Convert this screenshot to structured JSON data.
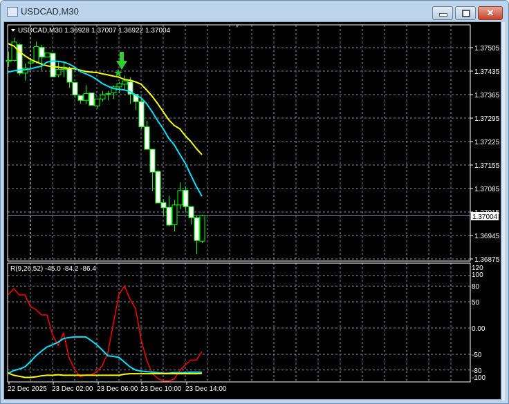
{
  "window": {
    "title": "USDCAD,M30",
    "minimize_icon": "minimize-icon",
    "maximize_icon": "maximize-icon",
    "close_icon": "close-icon"
  },
  "chart": {
    "header": "USDCAD,M30  1.36928 1.37007 1.36922 1.37004",
    "current_price": "1.37004",
    "price_ticks": [
      "1.37505",
      "1.37435",
      "1.37365",
      "1.37295",
      "1.37225",
      "1.37155",
      "1.37085",
      "1.37015",
      "1.36945",
      "1.36875"
    ],
    "time_ticks": [
      "22 Dec 2025",
      "23 Dec 02:00",
      "23 Dec 06:00",
      "23 Dec 10:00",
      "23 Dec 14:00"
    ],
    "colors": {
      "bull_outline": "#00ff00",
      "bear_body": "#ffffff",
      "ma_fast": "#00e5ff",
      "ma_slow": "#ffff00",
      "signal_arrow": "#32cd32",
      "indicator_red": "#ff0000"
    },
    "markers": {
      "sell_arrow": "arrow-down-icon",
      "signal_star": "star-icon"
    }
  },
  "indicator": {
    "header": "R(9,26,52) -45.0 -84.2 -86.4",
    "ticks": [
      "120",
      "100",
      "80",
      "50",
      "0.00",
      "-50",
      "-80",
      "-100"
    ]
  },
  "chart_data": [
    {
      "type": "candlestick",
      "symbol": "USDCAD",
      "timeframe": "M30",
      "ylim": [
        1.36875,
        1.37505
      ],
      "grid": true,
      "ohlc": [
        [
          1.37464,
          1.37493,
          1.37448,
          1.37467
        ],
        [
          1.37467,
          1.37534,
          1.37463,
          1.37522
        ],
        [
          1.37514,
          1.37517,
          1.37422,
          1.37429
        ],
        [
          1.37429,
          1.37458,
          1.37407,
          1.37444
        ],
        [
          1.37459,
          1.37475,
          1.37451,
          1.37462
        ],
        [
          1.37462,
          1.37523,
          1.37458,
          1.37508
        ],
        [
          1.37506,
          1.37513,
          1.37438,
          1.37477
        ],
        [
          1.37477,
          1.37489,
          1.37477,
          1.37489
        ],
        [
          1.37488,
          1.37489,
          1.37417,
          1.37418
        ],
        [
          1.37424,
          1.37462,
          1.37417,
          1.3744
        ],
        [
          1.3744,
          1.37462,
          1.37417,
          1.37447
        ],
        [
          1.37442,
          1.37448,
          1.37385,
          1.37402
        ],
        [
          1.37401,
          1.37401,
          1.37355,
          1.37364
        ],
        [
          1.37362,
          1.37362,
          1.37338,
          1.37348
        ],
        [
          1.37348,
          1.37393,
          1.37337,
          1.37368
        ],
        [
          1.3737,
          1.3737,
          1.37333,
          1.37333
        ],
        [
          1.37331,
          1.37352,
          1.37323,
          1.37352
        ],
        [
          1.37352,
          1.37376,
          1.37344,
          1.37364
        ],
        [
          1.37366,
          1.37376,
          1.37348,
          1.37368
        ],
        [
          1.37371,
          1.37392,
          1.37352,
          1.37388
        ],
        [
          1.37388,
          1.37403,
          1.37369,
          1.37398
        ],
        [
          1.37396,
          1.37422,
          1.37381,
          1.37406
        ],
        [
          1.37403,
          1.37417,
          1.37337,
          1.37367
        ],
        [
          1.37366,
          1.37366,
          1.37319,
          1.37344
        ],
        [
          1.37344,
          1.37352,
          1.37263,
          1.37269
        ],
        [
          1.37269,
          1.37287,
          1.37201,
          1.37202
        ],
        [
          1.37202,
          1.37202,
          1.37077,
          1.37134
        ],
        [
          1.37136,
          1.3714,
          1.37042,
          1.37042
        ],
        [
          1.37043,
          1.37053,
          1.37005,
          1.37028
        ],
        [
          1.37029,
          1.37064,
          1.36972,
          1.36976
        ],
        [
          1.36977,
          1.37051,
          1.36957,
          1.37036
        ],
        [
          1.37036,
          1.37103,
          1.37024,
          1.37079
        ],
        [
          1.3708,
          1.37091,
          1.37016,
          1.37031
        ],
        [
          1.37031,
          1.37031,
          1.36978,
          1.36998
        ],
        [
          1.36998,
          1.37005,
          1.36889,
          1.3693
        ],
        [
          1.36928,
          1.37007,
          1.36922,
          1.37004
        ]
      ],
      "ma_slow": [
        1.37517,
        1.3751,
        1.37493,
        1.37481,
        1.3747,
        1.37463,
        1.37456,
        1.37451,
        1.37448,
        1.37447,
        1.37444,
        1.37444,
        1.37442,
        1.37438,
        1.37434,
        1.37432,
        1.37431,
        1.37427,
        1.37424,
        1.3742,
        1.37417,
        1.3741,
        1.37408,
        1.37403,
        1.37396,
        1.37379,
        1.3736,
        1.37338,
        1.37314,
        1.3729,
        1.37273,
        1.37263,
        1.37242,
        1.37225,
        1.37204,
        1.37186
      ],
      "ma_fast": [
        1.37432,
        1.37436,
        1.37438,
        1.37439,
        1.37442,
        1.37446,
        1.3745,
        1.37462,
        1.37465,
        1.37464,
        1.37462,
        1.37456,
        1.37447,
        1.37434,
        1.37427,
        1.3742,
        1.3741,
        1.37398,
        1.3739,
        1.37383,
        1.37381,
        1.37379,
        1.37374,
        1.37364,
        1.37355,
        1.37338,
        1.37314,
        1.37287,
        1.37263,
        1.37235,
        1.37215,
        1.37187,
        1.3716,
        1.37125,
        1.37091,
        1.37062
      ],
      "sell_arrow_bar": 21,
      "star_bar": 20
    },
    {
      "type": "line",
      "ylim": [
        -103,
        125
      ],
      "grid": true,
      "series": [
        {
          "color": "#ff0000",
          "values": [
            64,
            75,
            63,
            63,
            41,
            35,
            25,
            25,
            -13,
            -33,
            -10,
            -57,
            -79,
            -93,
            -89,
            -89,
            -83,
            -72,
            -46,
            9,
            64,
            80,
            55,
            37,
            -22,
            -61,
            -86,
            -96,
            -101,
            -101,
            -97,
            -81,
            -70,
            -61,
            -61,
            -45.0
          ]
        },
        {
          "color": "#00e5ff",
          "values": [
            -86,
            -81,
            -78,
            -74,
            -64,
            -53,
            -44,
            -36,
            -32,
            -27,
            -20,
            -18,
            -17,
            -17,
            -17,
            -24,
            -32,
            -42,
            -53,
            -54,
            -56,
            -65,
            -74,
            -80,
            -82,
            -83,
            -84,
            -85,
            -86,
            -86,
            -85,
            -85,
            -85,
            -84,
            -84,
            -84.2
          ]
        },
        {
          "color": "#ffff00",
          "values": [
            -86,
            -90,
            -92,
            -94,
            -94,
            -93,
            -91,
            -90,
            -90,
            -89,
            -90,
            -90,
            -90,
            -90,
            -90,
            -90,
            -90,
            -90,
            -90,
            -90,
            -90,
            -88,
            -87,
            -87,
            -87,
            -87,
            -87,
            -87,
            -87,
            -87,
            -87,
            -87,
            -87,
            -87,
            -87,
            -86.4
          ]
        }
      ]
    }
  ]
}
